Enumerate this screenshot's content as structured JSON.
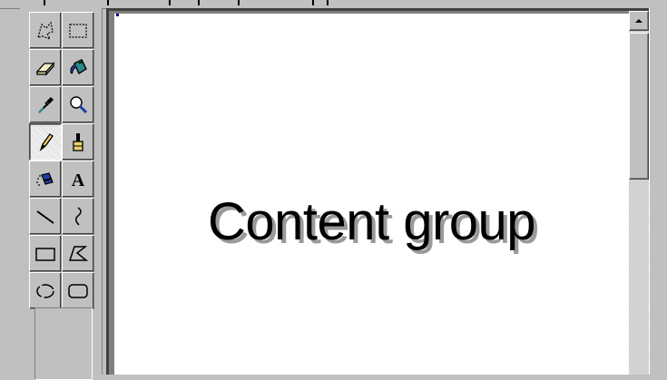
{
  "canvas": {
    "label": "Content group"
  },
  "tools": [
    {
      "id": "free-select",
      "icon": "free-form-select-icon"
    },
    {
      "id": "select",
      "icon": "select-icon"
    },
    {
      "id": "eraser",
      "icon": "eraser-icon"
    },
    {
      "id": "fill",
      "icon": "fill-bucket-icon"
    },
    {
      "id": "pick-color",
      "icon": "eyedropper-icon"
    },
    {
      "id": "magnifier",
      "icon": "magnifier-icon"
    },
    {
      "id": "pencil",
      "icon": "pencil-icon",
      "active": true
    },
    {
      "id": "brush",
      "icon": "brush-icon"
    },
    {
      "id": "airbrush",
      "icon": "airbrush-icon"
    },
    {
      "id": "text",
      "icon": "text-icon",
      "glyph": "A"
    },
    {
      "id": "line",
      "icon": "line-icon"
    },
    {
      "id": "curve",
      "icon": "curve-icon"
    },
    {
      "id": "rectangle",
      "icon": "rectangle-icon"
    },
    {
      "id": "polygon",
      "icon": "polygon-icon"
    },
    {
      "id": "ellipse",
      "icon": "ellipse-icon"
    },
    {
      "id": "rounded-rectangle",
      "icon": "rounded-rectangle-icon"
    }
  ],
  "colors": {
    "face": "#c0c0c0",
    "shadow": "#808080",
    "highlight": "#ffffff",
    "canvas": "#ffffff",
    "accent_blue": "#1f3fa8",
    "accent_teal": "#2a8a8a"
  }
}
